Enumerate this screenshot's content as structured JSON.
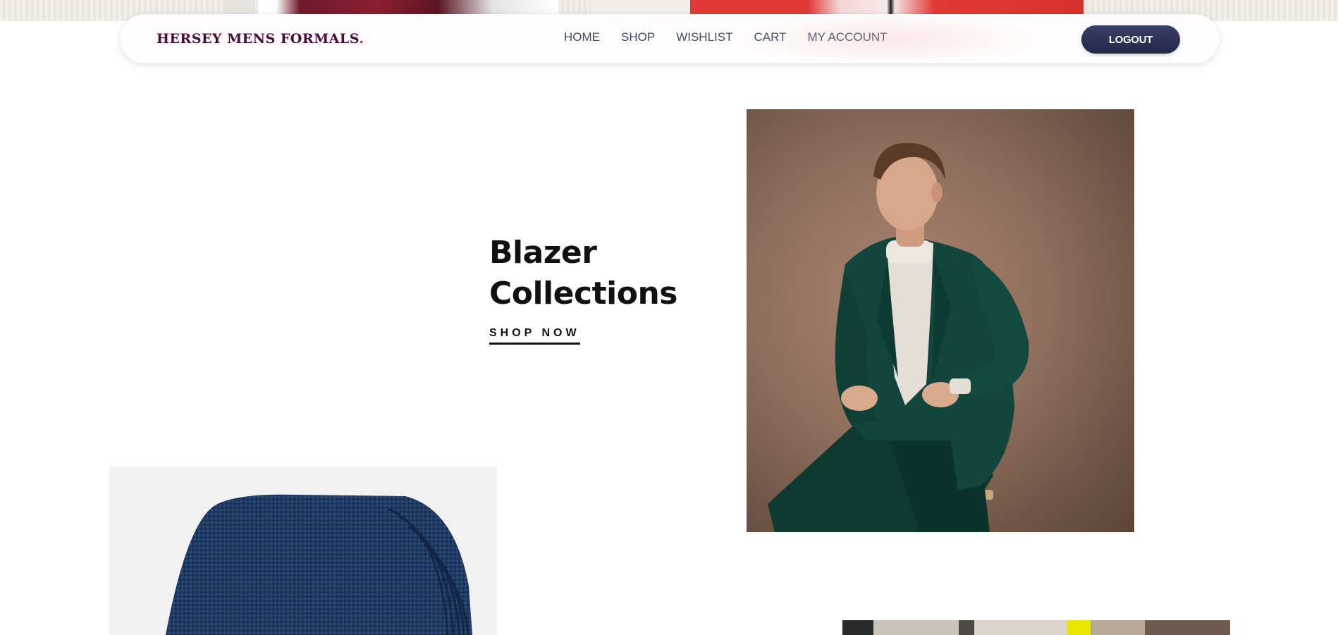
{
  "header": {
    "logo_text": "HERSEY MENS FORMALS",
    "logo_dot": ".",
    "nav": [
      {
        "label": "HOME"
      },
      {
        "label": "SHOP"
      },
      {
        "label": "WISHLIST"
      },
      {
        "label": "CART"
      },
      {
        "label": "MY ACCOUNT"
      }
    ],
    "logout_label": "LOGOUT"
  },
  "hero": {
    "title_line1": "Blazer",
    "title_line2": "Collections",
    "cta_label": "SHOP NOW"
  },
  "colors": {
    "logo": "#4a0b3c",
    "logout_bg": "#2b2f52",
    "nav_text": "#3d4a6b"
  }
}
